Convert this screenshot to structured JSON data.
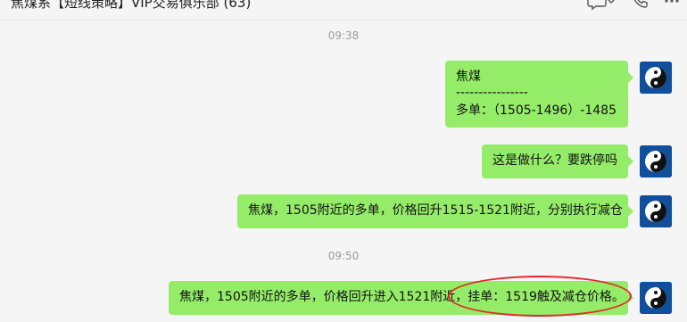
{
  "window": {
    "title": "焦煤系【短线策略】VIP交易俱乐部 (63)",
    "icons": [
      "chat-bubble-icon",
      "chevron-down-icon",
      "phone-icon",
      "more-icon"
    ]
  },
  "messages": [
    {
      "type": "timestamp",
      "text": "09:38"
    },
    {
      "type": "sent",
      "lines": [
        "焦煤",
        "----------------",
        "多单：（1505-1496）-1485"
      ],
      "avatar": "yin-yang-avatar"
    },
    {
      "type": "sent",
      "lines": [
        "这是做什么？要跌停吗"
      ],
      "avatar": "yin-yang-avatar"
    },
    {
      "type": "sent",
      "lines": [
        "焦煤，1505附近的多单，价格回升1515-1521附近，分别执行减仓"
      ],
      "avatar": "yin-yang-avatar"
    },
    {
      "type": "timestamp",
      "text": "09:50"
    },
    {
      "type": "sent",
      "lines": [
        "焦煤，1505附近的多单，价格回升进入1521附近，挂单：1519触及减仓价格。"
      ],
      "avatar": "yin-yang-avatar"
    }
  ],
  "annotation": {
    "type": "red-ellipse",
    "target_text": "挂单：1519触及减仓价格。",
    "color": "#e3262b"
  },
  "colors": {
    "bubble": "#95ec69",
    "background": "#f5f5f5",
    "timestamp": "#9a9a9a",
    "avatar_bg": "#0f4f9c"
  }
}
